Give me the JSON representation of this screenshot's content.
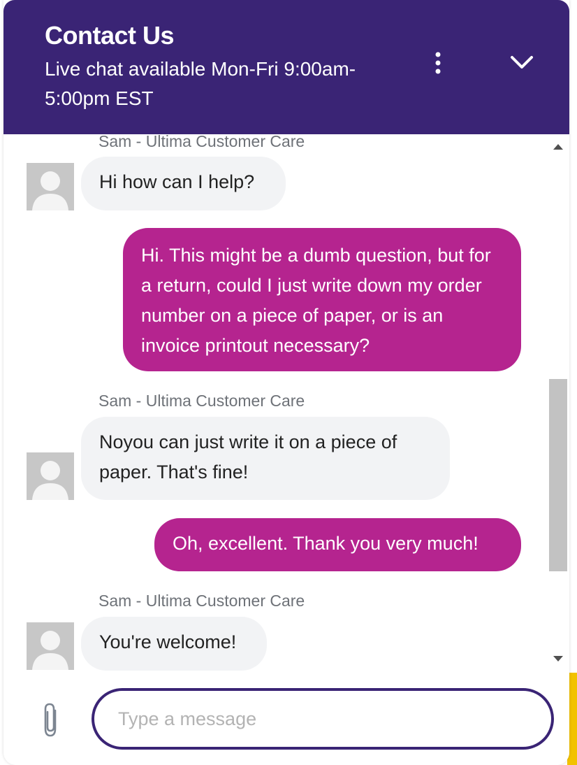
{
  "header": {
    "title": "Contact Us",
    "subtitle": "Live chat available Mon-Fri 9:00am-5:00pm EST",
    "menu_icon": "more-vertical-icon",
    "collapse_icon": "chevron-down-icon"
  },
  "colors": {
    "header_bg": "#3a2475",
    "user_bubble": "#b5248f",
    "agent_bubble": "#f2f3f5",
    "accent_yellow": "#f2c200"
  },
  "messages": [
    {
      "from": "agent",
      "sender": "Sam - Ultima Customer Care",
      "text": "Hi how can I help?"
    },
    {
      "from": "user",
      "text": "Hi. This might be a dumb question, but for a return, could I just write down my order number on a piece of paper, or is an invoice printout necessary?"
    },
    {
      "from": "agent",
      "sender": "Sam - Ultima Customer Care",
      "text": "Noyou can just write it on a piece of paper. That's fine!"
    },
    {
      "from": "user",
      "text": "Oh, excellent. Thank you very much!"
    },
    {
      "from": "agent",
      "sender": "Sam - Ultima Customer Care",
      "text": "You're welcome!"
    }
  ],
  "composer": {
    "placeholder": "Type a message",
    "value": "",
    "attach_icon": "paperclip-icon"
  }
}
